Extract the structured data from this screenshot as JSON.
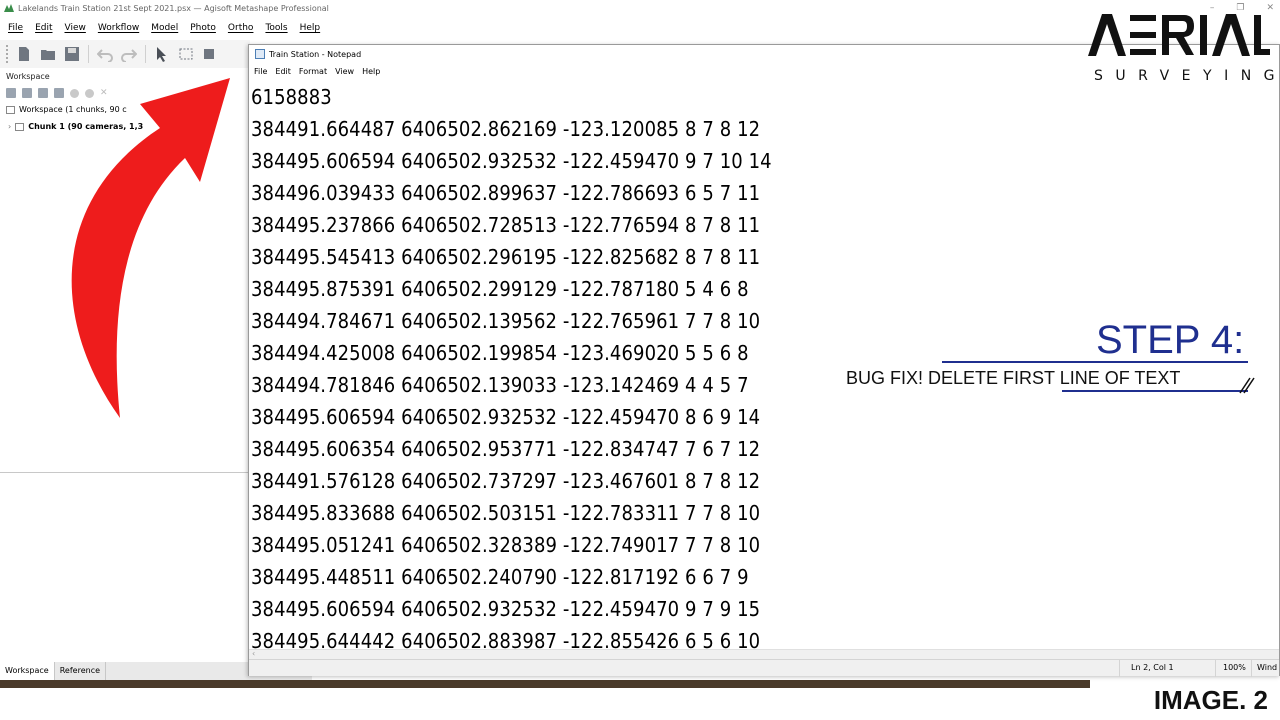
{
  "metashape": {
    "title": "Lakelands Train Station 21st Sept 2021.psx — Agisoft Metashape Professional",
    "menu": [
      "File",
      "Edit",
      "View",
      "Workflow",
      "Model",
      "Photo",
      "Ortho",
      "Tools",
      "Help"
    ],
    "workspace_label": "Workspace",
    "workspace_root": "Workspace (1 chunks, 90 c",
    "chunk_label": "Chunk 1 (90 cameras, 1,3",
    "bottom_tabs": [
      "Workspace",
      "Reference"
    ]
  },
  "notepad": {
    "title": "Train Station - Notepad",
    "menu": [
      "File",
      "Edit",
      "Format",
      "View",
      "Help"
    ],
    "lines": [
      "6158883",
      "384491.664487 6406502.862169 -123.120085 8 7 8 12",
      "384495.606594 6406502.932532 -122.459470 9 7 10 14",
      "384496.039433 6406502.899637 -122.786693 6 5 7 11",
      "384495.237866 6406502.728513 -122.776594 8 7 8 11",
      "384495.545413 6406502.296195 -122.825682 8 7 8 11",
      "384495.875391 6406502.299129 -122.787180 5 4 6 8",
      "384494.784671 6406502.139562 -122.765961 7 7 8 10",
      "384494.425008 6406502.199854 -123.469020 5 5 6 8",
      "384494.781846 6406502.139033 -123.142469 4 4 5 7",
      "384495.606594 6406502.932532 -122.459470 8 6 9 14",
      "384495.606354 6406502.953771 -122.834747 7 6 7 12",
      "384491.576128 6406502.737297 -123.467601 8 7 8 12",
      "384495.833688 6406502.503151 -122.783311 7 7 8 10",
      "384495.051241 6406502.328389 -122.749017 7 7 8 10",
      "384495.448511 6406502.240790 -122.817192 6 6 7 9",
      "384495.606594 6406502.932532 -122.459470 9 7 9 15",
      "384495.644442 6406502.883987 -122.855426 6 5 6 10"
    ],
    "status": {
      "position": "Ln 2, Col 1",
      "zoom": "100%",
      "encoding": "Wind"
    }
  },
  "logo": {
    "main": "AERIAL",
    "sub": "SURVEYING"
  },
  "step": {
    "title": "STEP 4:",
    "subtitle": "BUG FIX! DELETE FIRST LINE OF TEXT"
  },
  "image_label": "IMAGE. 2",
  "colors": {
    "arrow": "#ee1c1c",
    "step_blue": "#1f2f8f"
  }
}
